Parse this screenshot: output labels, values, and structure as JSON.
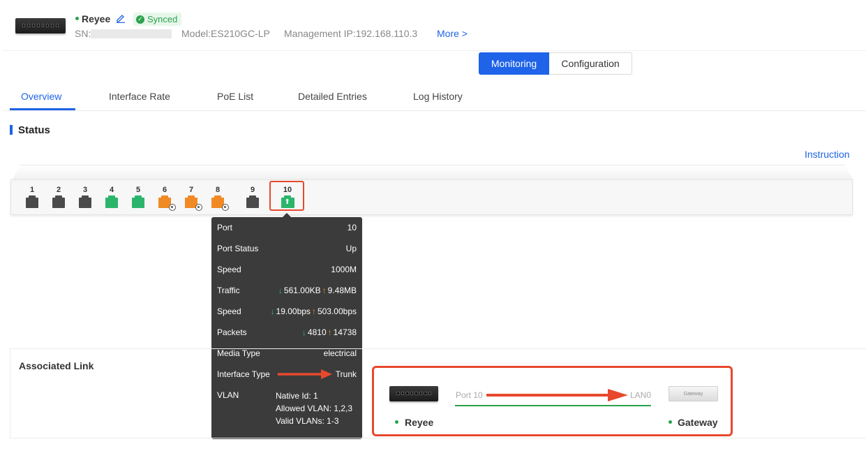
{
  "device": {
    "name": "Reyee",
    "synced": "Synced",
    "sn_label": "SN:",
    "model": "Model:ES210GC-LP",
    "mgmt_ip": "Management IP:192.168.110.3",
    "more": "More >"
  },
  "mode": {
    "monitoring": "Monitoring",
    "configuration": "Configuration",
    "active": "Monitoring"
  },
  "tabs": [
    {
      "label": "Overview",
      "active": true
    },
    {
      "label": "Interface Rate"
    },
    {
      "label": "PoE List"
    },
    {
      "label": "Detailed Entries"
    },
    {
      "label": "Log History"
    }
  ],
  "status": {
    "title": "Status",
    "instruction": "Instruction"
  },
  "ports": [
    {
      "num": "1",
      "state": "gray"
    },
    {
      "num": "2",
      "state": "gray"
    },
    {
      "num": "3",
      "state": "gray"
    },
    {
      "num": "4",
      "state": "green"
    },
    {
      "num": "5",
      "state": "green"
    },
    {
      "num": "6",
      "state": "orange-poe"
    },
    {
      "num": "7",
      "state": "orange-poe"
    },
    {
      "num": "8",
      "state": "orange-poe"
    },
    {
      "num": "9",
      "state": "gray"
    },
    {
      "num": "10",
      "state": "green-uplink",
      "selected": true
    }
  ],
  "tooltip": {
    "port": {
      "label": "Port",
      "value": "10"
    },
    "port_status": {
      "label": "Port Status",
      "value": "Up"
    },
    "speed": {
      "label": "Speed",
      "value": "1000M"
    },
    "traffic": {
      "label": "Traffic",
      "down": "561.00KB",
      "up": "9.48MB"
    },
    "rate": {
      "label": "Speed",
      "down": "19.00bps",
      "up": "503.00bps"
    },
    "packets": {
      "label": "Packets",
      "down": "4810",
      "up": "14738"
    },
    "media_type": {
      "label": "Media Type",
      "value": "electrical"
    },
    "interface_type": {
      "label": "Interface Type",
      "value": "Trunk"
    },
    "vlan": {
      "label": "VLAN",
      "native": "Native Id: 1",
      "allowed": "Allowed VLAN: 1,2,3",
      "valid": "Valid VLANs: 1-3"
    }
  },
  "associated_link": {
    "title": "Associated Link",
    "left_port": "Port 10",
    "right_port": "LAN0",
    "left_device": "Reyee",
    "right_device": "Gateway",
    "gateway_img_label": "Gateway"
  },
  "colors": {
    "accent": "#1e63e8",
    "online": "#2ba24c",
    "highlight": "#e8492d",
    "poe": "#f08a24"
  }
}
